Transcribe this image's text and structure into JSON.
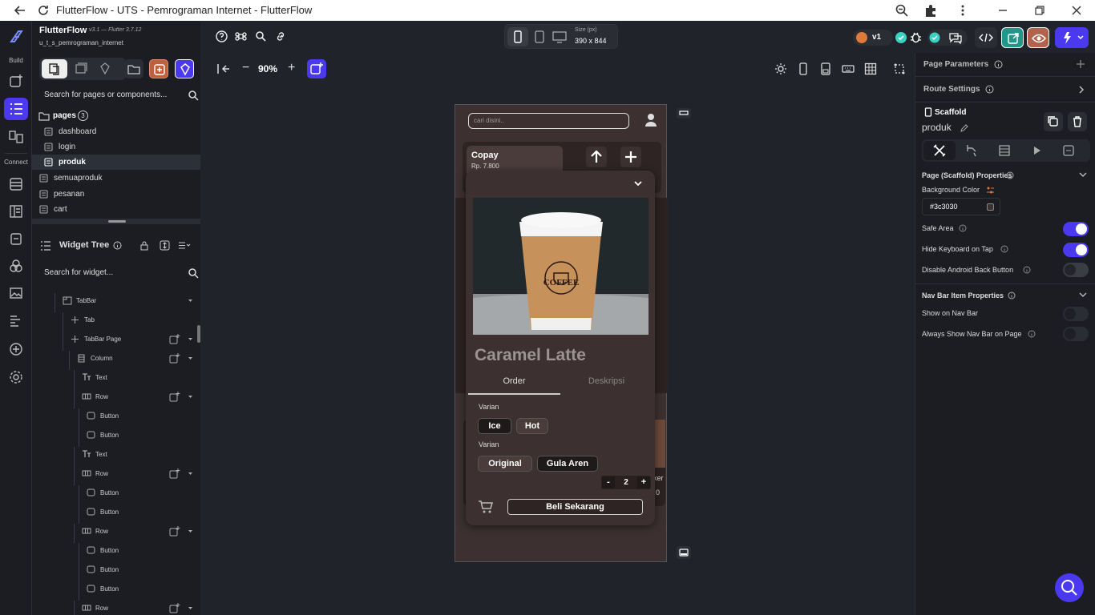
{
  "window": {
    "title": "FlutterFlow - UTS - Pemrograman Internet - FlutterFlow"
  },
  "rail": {
    "build_label": "Build",
    "connect_label": "Connect"
  },
  "project": {
    "name": "FlutterFlow",
    "version": "v3.1 — Flutter 3.7.12",
    "id": "u_t_s_pemrograman_internet"
  },
  "page_search": {
    "placeholder": "Search for pages or components..."
  },
  "pages": {
    "folder_label": "pages",
    "count": "3",
    "items": [
      {
        "label": "dashboard"
      },
      {
        "label": "login"
      },
      {
        "label": "produk"
      },
      {
        "label": "semuaproduk"
      },
      {
        "label": "pesanan"
      },
      {
        "label": "cart"
      }
    ]
  },
  "widget_tree": {
    "title": "Widget Tree",
    "search_placeholder": "Search for widget...",
    "items": [
      {
        "label": "TabBar"
      },
      {
        "label": "Tab"
      },
      {
        "label": "TabBar Page"
      },
      {
        "label": "Column"
      },
      {
        "label": "Text"
      },
      {
        "label": "Row"
      },
      {
        "label": "Button"
      },
      {
        "label": "Button"
      },
      {
        "label": "Text"
      },
      {
        "label": "Row"
      },
      {
        "label": "Button"
      },
      {
        "label": "Button"
      },
      {
        "label": "Row"
      },
      {
        "label": "Button"
      },
      {
        "label": "Button"
      },
      {
        "label": "Button"
      },
      {
        "label": "Row"
      }
    ]
  },
  "canvas": {
    "zoom": "90%",
    "size_label": "Size (px)",
    "size_value": "390 x 844",
    "version_badge": "v1"
  },
  "phone": {
    "search_placeholder": "cari disini..",
    "card_title": "Copay",
    "card_price": "Rp. 7.800",
    "sheet": {
      "product_name": "Caramel Latte",
      "cup_text": "COFFEE",
      "tabs": [
        {
          "label": "Order"
        },
        {
          "label": "Deskripsi"
        }
      ],
      "variant_label_1": "Varian",
      "variant_options_1": [
        "Ice",
        "Hot"
      ],
      "variant_label_2": "Varian",
      "variant_options_2": [
        "Original",
        "Gula Aren"
      ],
      "qty_minus": "-",
      "qty_value": "2",
      "qty_plus": "+",
      "buy_button": "Beli Sekarang"
    },
    "bg_peek_text_1": "ker",
    "bg_peek_text_2": "0"
  },
  "right": {
    "page_parameters": "Page Parameters",
    "route_settings": "Route Settings",
    "scaffold_label": "Scaffold",
    "page_name": "produk",
    "properties_title": "Page (Scaffold) Properties",
    "bg_color_label": "Background Color",
    "bg_color_value": "#3c3030",
    "safe_area": "Safe Area",
    "hide_keyboard": "Hide Keyboard on Tap",
    "disable_back": "Disable Android Back Button",
    "navbar_title": "Nav Bar Item Properties",
    "show_navbar": "Show on Nav Bar",
    "always_show": "Always Show Nav Bar on Page"
  },
  "colors": {
    "accent": "#4b39ef",
    "page_bg": "#3c3030",
    "panel_bg": "#1b1d22",
    "toggle_on": "#4b39ef",
    "toggle_off": "#3a3d44"
  }
}
